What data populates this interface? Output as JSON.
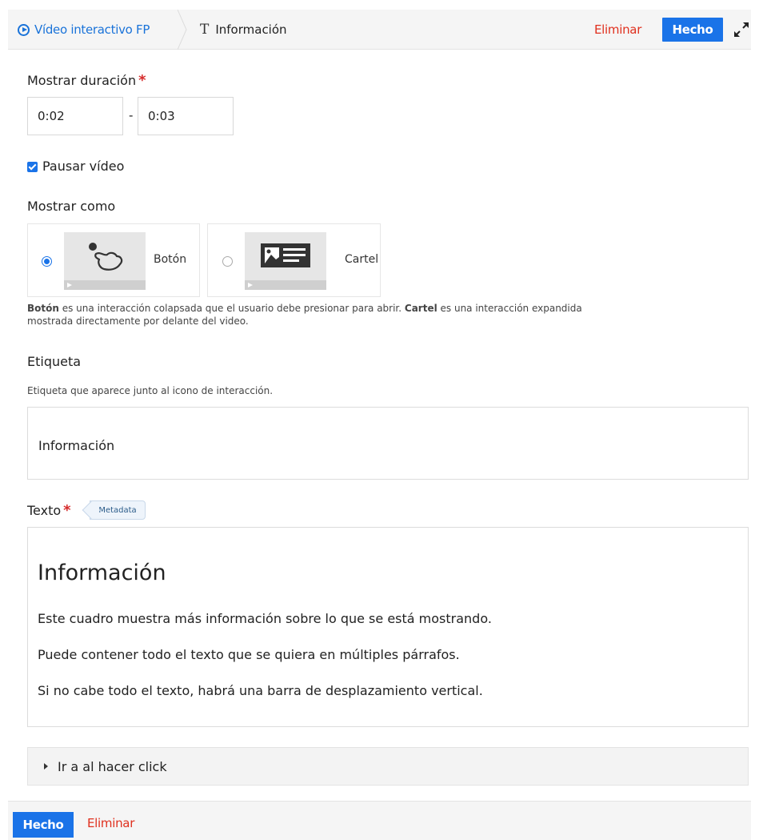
{
  "header": {
    "breadcrumb_root": "Vídeo interactivo FP",
    "breadcrumb_current": "Información",
    "delete_label": "Eliminar",
    "done_label": "Hecho"
  },
  "duration": {
    "label": "Mostrar duración",
    "required_mark": "*",
    "start": "0:02",
    "separator": "-",
    "end": "0:03"
  },
  "pause_video": {
    "label": "Pausar vídeo",
    "checked": true
  },
  "display_as": {
    "label": "Mostrar como",
    "options": [
      {
        "label": "Botón",
        "selected": true
      },
      {
        "label": "Cartel",
        "selected": false
      }
    ],
    "help_button_term": "Botón",
    "help_text_1": " es una interacción colapsada que el usuario debe presionar para abrir. ",
    "help_poster_term": "Cartel",
    "help_text_2": " es una interacción expandida",
    "help_text_3": "mostrada directamente por delante del video."
  },
  "tag": {
    "label": "Etiqueta",
    "description": "Etiqueta que aparece junto al icono de interacción.",
    "value": "Información"
  },
  "text": {
    "label": "Texto",
    "required_mark": "*",
    "metadata_label": "Metadata",
    "heading": "Información",
    "paragraphs": [
      "Este cuadro muestra más información sobre lo que se está mostrando.",
      "Puede contener todo el texto que se quiera en múltiples párrafos.",
      "Si no cabe todo el texto, habrá una barra de desplazamiento vertical."
    ]
  },
  "goto": {
    "label": "Ir a al hacer click"
  },
  "footer": {
    "done_label": "Hecho",
    "delete_label": "Eliminar"
  },
  "colors": {
    "accent": "#1a73e8",
    "danger": "#e0301e",
    "required": "#d62b2b"
  }
}
